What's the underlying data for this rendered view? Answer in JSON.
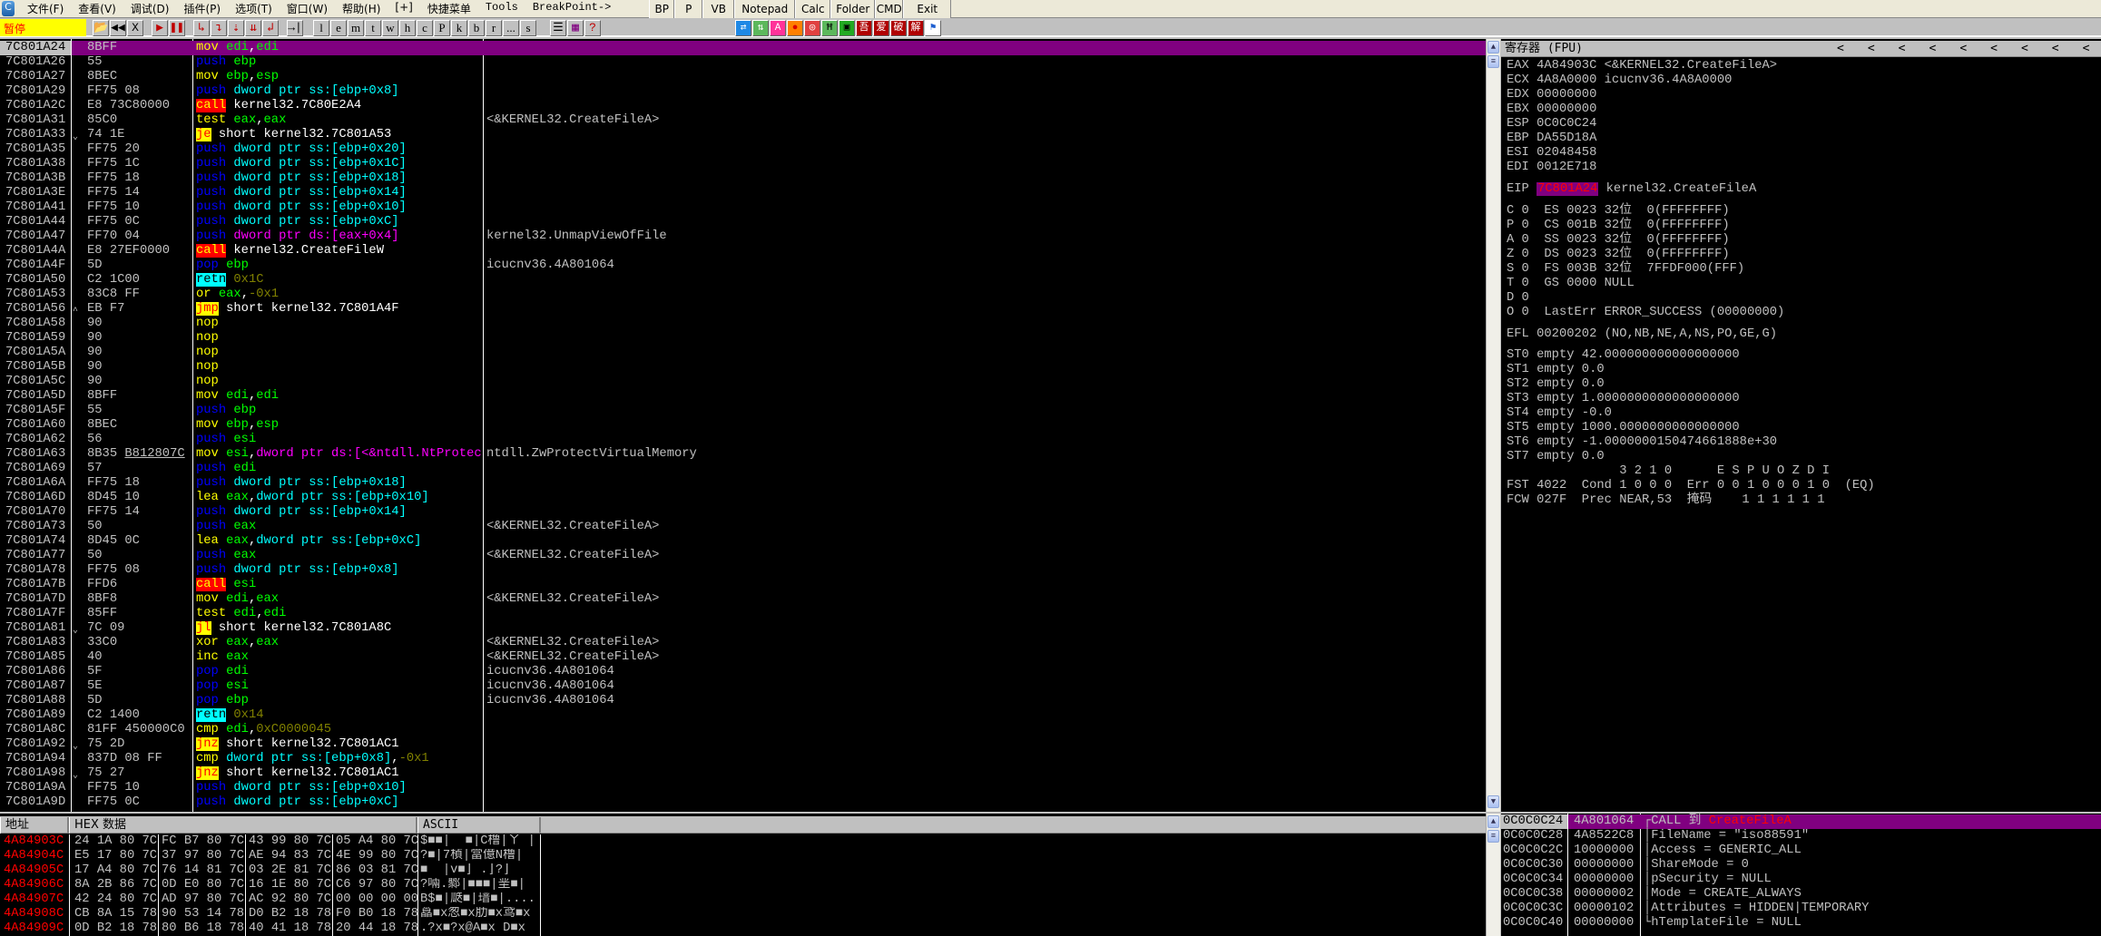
{
  "menubar": {
    "items": [
      "文件(F)",
      "查看(V)",
      "调试(D)",
      "插件(P)",
      "选项(T)",
      "窗口(W)",
      "帮助(H)",
      "[+]",
      "快捷菜单"
    ],
    "mono_items": [
      "Tools",
      "BreakPoint->"
    ],
    "quick_buttons": [
      "BP",
      "P",
      "VB",
      "Notepad",
      "Calc",
      "Folder",
      "CMD",
      "Exit"
    ]
  },
  "toolbar": {
    "status": "暂停",
    "controls": [
      {
        "g": "📂",
        "n": "open-icon",
        "c": "#b08000"
      },
      {
        "g": "◀◀",
        "n": "rewind-icon",
        "c": "#000"
      },
      {
        "g": "X",
        "n": "close-icon",
        "c": "#000"
      },
      {
        "g": "▶",
        "n": "run-icon",
        "c": "#c00000"
      },
      {
        "g": "❚❚",
        "n": "pause-icon",
        "c": "#c00000"
      },
      {
        "g": "↳",
        "n": "step-into-icon",
        "c": "#c00000"
      },
      {
        "g": "↴",
        "n": "step-over-icon",
        "c": "#c00000"
      },
      {
        "g": "⇣",
        "n": "trace-into-icon",
        "c": "#c00000"
      },
      {
        "g": "⇊",
        "n": "trace-over-icon",
        "c": "#c00000"
      },
      {
        "g": "↲",
        "n": "execute-till-return-icon",
        "c": "#c00000"
      },
      {
        "g": "→|",
        "n": "goto-icon",
        "c": "#000"
      }
    ],
    "letters": [
      "l",
      "e",
      "m",
      "t",
      "w",
      "h",
      "c",
      "P",
      "k",
      "b",
      "r",
      "...",
      "s"
    ],
    "extra": [
      {
        "g": "☰",
        "n": "list-icon",
        "c": "#000"
      },
      {
        "g": "▦",
        "n": "options-icon",
        "c": "#800080"
      },
      {
        "g": "?",
        "n": "help-icon",
        "c": "#c00000"
      }
    ],
    "plugins": [
      {
        "g": "⇄",
        "n": "swap-icon",
        "bg": "#1e88e5",
        "c": "#fff"
      },
      {
        "g": "⇅",
        "n": "updown-icon",
        "bg": "#5cb85c",
        "c": "#fff"
      },
      {
        "g": "A",
        "n": "ascii-icon",
        "bg": "#ff3399",
        "c": "#fff"
      },
      {
        "g": "●",
        "n": "record-icon",
        "bg": "#ff8000",
        "c": "#d00"
      },
      {
        "g": "◎",
        "n": "target-icon",
        "bg": "#e04040",
        "c": "#fff"
      },
      {
        "g": "Ħ",
        "n": "hex-icon",
        "bg": "#5cb85c",
        "c": "#000"
      },
      {
        "g": "▣",
        "n": "window-icon",
        "bg": "#22aa22",
        "c": "#000"
      },
      {
        "g": "吾",
        "n": "wu-icon",
        "bg": "#b00000",
        "c": "#fff"
      },
      {
        "g": "爱",
        "n": "ai-icon",
        "bg": "#b00000",
        "c": "#fff"
      },
      {
        "g": "破",
        "n": "po-icon",
        "bg": "#b00000",
        "c": "#fff"
      },
      {
        "g": "解",
        "n": "jie-icon",
        "bg": "#b00000",
        "c": "#fff"
      },
      {
        "g": "⚑",
        "n": "flag-icon",
        "bg": "#fff",
        "c": "#1e5fd0"
      }
    ]
  },
  "disasm": {
    "current": "7C801A24",
    "rows": [
      {
        "a": "7C801A24",
        "j": "",
        "h": "8BFF",
        "i": "mov edi,edi",
        "c": ""
      },
      {
        "a": "7C801A26",
        "j": "",
        "h": "55",
        "i": "push ebp",
        "c": ""
      },
      {
        "a": "7C801A27",
        "j": "",
        "h": "8BEC",
        "i": "mov ebp,esp",
        "c": ""
      },
      {
        "a": "7C801A29",
        "j": "",
        "h": "FF75 08",
        "i": "push dword ptr ss:[ebp+0x8]",
        "c": ""
      },
      {
        "a": "7C801A2C",
        "j": "",
        "h": "E8 73C80000",
        "i": "call kernel32.7C80E2A4",
        "c": ""
      },
      {
        "a": "7C801A31",
        "j": "",
        "h": "85C0",
        "i": "test eax,eax",
        "c": "<&KERNEL32.CreateFileA>"
      },
      {
        "a": "7C801A33",
        "j": "⌄",
        "h": "74 1E",
        "i": "je short kernel32.7C801A53",
        "c": ""
      },
      {
        "a": "7C801A35",
        "j": "",
        "h": "FF75 20",
        "i": "push dword ptr ss:[ebp+0x20]",
        "c": ""
      },
      {
        "a": "7C801A38",
        "j": "",
        "h": "FF75 1C",
        "i": "push dword ptr ss:[ebp+0x1C]",
        "c": ""
      },
      {
        "a": "7C801A3B",
        "j": "",
        "h": "FF75 18",
        "i": "push dword ptr ss:[ebp+0x18]",
        "c": ""
      },
      {
        "a": "7C801A3E",
        "j": "",
        "h": "FF75 14",
        "i": "push dword ptr ss:[ebp+0x14]",
        "c": ""
      },
      {
        "a": "7C801A41",
        "j": "",
        "h": "FF75 10",
        "i": "push dword ptr ss:[ebp+0x10]",
        "c": ""
      },
      {
        "a": "7C801A44",
        "j": "",
        "h": "FF75 0C",
        "i": "push dword ptr ss:[ebp+0xC]",
        "c": ""
      },
      {
        "a": "7C801A47",
        "j": "",
        "h": "FF70 04",
        "i": "push dword ptr ds:[eax+0x4]",
        "c": "kernel32.UnmapViewOfFile"
      },
      {
        "a": "7C801A4A",
        "j": "",
        "h": "E8 27EF0000",
        "i": "call kernel32.CreateFileW",
        "c": ""
      },
      {
        "a": "7C801A4F",
        "j": "",
        "h": "5D",
        "i": "pop ebp",
        "c": "icucnv36.4A801064"
      },
      {
        "a": "7C801A50",
        "j": "",
        "h": "C2 1C00",
        "i": "retn 0x1C",
        "c": ""
      },
      {
        "a": "7C801A53",
        "j": "",
        "h": "83C8 FF",
        "i": "or eax,-0x1",
        "c": ""
      },
      {
        "a": "7C801A56",
        "j": "^",
        "h": "EB F7",
        "i": "jmp short kernel32.7C801A4F",
        "c": ""
      },
      {
        "a": "7C801A58",
        "j": "",
        "h": "90",
        "i": "nop",
        "c": ""
      },
      {
        "a": "7C801A59",
        "j": "",
        "h": "90",
        "i": "nop",
        "c": ""
      },
      {
        "a": "7C801A5A",
        "j": "",
        "h": "90",
        "i": "nop",
        "c": ""
      },
      {
        "a": "7C801A5B",
        "j": "",
        "h": "90",
        "i": "nop",
        "c": ""
      },
      {
        "a": "7C801A5C",
        "j": "",
        "h": "90",
        "i": "nop",
        "c": ""
      },
      {
        "a": "7C801A5D",
        "j": "",
        "h": "8BFF",
        "i": "mov edi,edi",
        "c": ""
      },
      {
        "a": "7C801A5F",
        "j": "",
        "h": "55",
        "i": "push ebp",
        "c": ""
      },
      {
        "a": "7C801A60",
        "j": "",
        "h": "8BEC",
        "i": "mov ebp,esp",
        "c": ""
      },
      {
        "a": "7C801A62",
        "j": "",
        "h": "56",
        "i": "push esi",
        "c": ""
      },
      {
        "a": "7C801A63",
        "j": "",
        "h": "8B35",
        "hu": "B812807C",
        "i": "mov esi,dword ptr ds:[<&ntdll.NtProtect",
        "c": "ntdll.ZwProtectVirtualMemory"
      },
      {
        "a": "7C801A69",
        "j": "",
        "h": "57",
        "i": "push edi",
        "c": ""
      },
      {
        "a": "7C801A6A",
        "j": "",
        "h": "FF75 18",
        "i": "push dword ptr ss:[ebp+0x18]",
        "c": ""
      },
      {
        "a": "7C801A6D",
        "j": "",
        "h": "8D45 10",
        "i": "lea eax,dword ptr ss:[ebp+0x10]",
        "c": ""
      },
      {
        "a": "7C801A70",
        "j": "",
        "h": "FF75 14",
        "i": "push dword ptr ss:[ebp+0x14]",
        "c": ""
      },
      {
        "a": "7C801A73",
        "j": "",
        "h": "50",
        "i": "push eax",
        "c": "<&KERNEL32.CreateFileA>"
      },
      {
        "a": "7C801A74",
        "j": "",
        "h": "8D45 0C",
        "i": "lea eax,dword ptr ss:[ebp+0xC]",
        "c": ""
      },
      {
        "a": "7C801A77",
        "j": "",
        "h": "50",
        "i": "push eax",
        "c": "<&KERNEL32.CreateFileA>"
      },
      {
        "a": "7C801A78",
        "j": "",
        "h": "FF75 08",
        "i": "push dword ptr ss:[ebp+0x8]",
        "c": ""
      },
      {
        "a": "7C801A7B",
        "j": "",
        "h": "FFD6",
        "i": "call esi",
        "c": ""
      },
      {
        "a": "7C801A7D",
        "j": "",
        "h": "8BF8",
        "i": "mov edi,eax",
        "c": "<&KERNEL32.CreateFileA>"
      },
      {
        "a": "7C801A7F",
        "j": "",
        "h": "85FF",
        "i": "test edi,edi",
        "c": ""
      },
      {
        "a": "7C801A81",
        "j": "⌄",
        "h": "7C 09",
        "i": "jl short kernel32.7C801A8C",
        "c": ""
      },
      {
        "a": "7C801A83",
        "j": "",
        "h": "33C0",
        "i": "xor eax,eax",
        "c": "<&KERNEL32.CreateFileA>"
      },
      {
        "a": "7C801A85",
        "j": "",
        "h": "40",
        "i": "inc eax",
        "c": "<&KERNEL32.CreateFileA>"
      },
      {
        "a": "7C801A86",
        "j": "",
        "h": "5F",
        "i": "pop edi",
        "c": "icucnv36.4A801064"
      },
      {
        "a": "7C801A87",
        "j": "",
        "h": "5E",
        "i": "pop esi",
        "c": "icucnv36.4A801064"
      },
      {
        "a": "7C801A88",
        "j": "",
        "h": "5D",
        "i": "pop ebp",
        "c": "icucnv36.4A801064"
      },
      {
        "a": "7C801A89",
        "j": "",
        "h": "C2 1400",
        "i": "retn 0x14",
        "c": ""
      },
      {
        "a": "7C801A8C",
        "j": "",
        "h": "81FF 450000C0",
        "i": "cmp edi,0xC0000045",
        "c": ""
      },
      {
        "a": "7C801A92",
        "j": "⌄",
        "h": "75 2D",
        "i": "jnz short kernel32.7C801AC1",
        "c": ""
      },
      {
        "a": "7C801A94",
        "j": "",
        "h": "837D 08 FF",
        "i": "cmp dword ptr ss:[ebp+0x8],-0x1",
        "c": ""
      },
      {
        "a": "7C801A98",
        "j": "⌄",
        "h": "75 27",
        "i": "jnz short kernel32.7C801AC1",
        "c": ""
      },
      {
        "a": "7C801A9A",
        "j": "",
        "h": "FF75 10",
        "i": "push dword ptr ss:[ebp+0x10]",
        "c": ""
      },
      {
        "a": "7C801A9D",
        "j": "",
        "h": "FF75 0C",
        "i": "push dword ptr ss:[ebp+0xC]",
        "c": ""
      }
    ]
  },
  "registers": {
    "title": "寄存器 (FPU)",
    "arrows": [
      "<",
      "<",
      "<",
      "<",
      "<",
      "<",
      "<",
      "<",
      "<"
    ],
    "gp": [
      {
        "n": "EAX",
        "v": "4A84903C",
        "c": "<&KERNEL32.CreateFileA>"
      },
      {
        "n": "ECX",
        "v": "4A8A0000",
        "c": "icucnv36.4A8A0000"
      },
      {
        "n": "EDX",
        "v": "00000000",
        "c": ""
      },
      {
        "n": "EBX",
        "v": "00000000",
        "c": ""
      },
      {
        "n": "ESP",
        "v": "0C0C0C24",
        "c": ""
      },
      {
        "n": "EBP",
        "v": "DA55D18A",
        "c": ""
      },
      {
        "n": "ESI",
        "v": "02048458",
        "c": ""
      },
      {
        "n": "EDI",
        "v": "0012E718",
        "c": ""
      }
    ],
    "eip": {
      "n": "EIP",
      "v": "7C801A24",
      "c": "kernel32.CreateFileA"
    },
    "flags": [
      "C 0  ES 0023 32位  0(FFFFFFFF)",
      "P 0  CS 001B 32位  0(FFFFFFFF)",
      "A 0  SS 0023 32位  0(FFFFFFFF)",
      "Z 0  DS 0023 32位  0(FFFFFFFF)",
      "S 0  FS 003B 32位  7FFDF000(FFF)",
      "T 0  GS 0000 NULL",
      "D 0",
      "O 0  LastErr ERROR_SUCCESS (00000000)"
    ],
    "efl": "EFL 00200202 (NO,NB,NE,A,NS,PO,GE,G)",
    "fpu": [
      "ST0 empty 42.000000000000000000",
      "ST1 empty 0.0",
      "ST2 empty 0.0",
      "ST3 empty 1.0000000000000000000",
      "ST4 empty -0.0",
      "ST5 empty 1000.0000000000000000",
      "ST6 empty -1.0000000150474661888e+30",
      "ST7 empty 0.0",
      "               3 2 1 0      E S P U O Z D I",
      "FST 4022  Cond 1 0 0 0  Err 0 0 1 0 0 0 1 0  (EQ)",
      "FCW 027F  Prec NEAR,53  掩码    1 1 1 1 1 1"
    ]
  },
  "dump": {
    "headers": {
      "addr": "地址",
      "hex": "HEX 数据",
      "ascii": "ASCII"
    },
    "rows": [
      {
        "a": "4A84903C",
        "h": [
          "24 1A 80 7C",
          "FC B7 80 7C",
          "43 99 80 7C",
          "05 A4 80 7C"
        ],
        "s": "$■■|  ■|C橹|ㄚ |"
      },
      {
        "a": "4A84904C",
        "h": [
          "E5 17 80 7C",
          "37 97 80 7C",
          "AE 94 83 7C",
          "4E 99 80 7C"
        ],
        "s": "?■|7楨|當億N橹|"
      },
      {
        "a": "4A84905C",
        "h": [
          "17 A4 80 7C",
          "76 14 81 7C",
          "03 2E 81 7C",
          "86 03 81 7C"
        ],
        "s": "■  |v■⌋ .⌋?⌋"
      },
      {
        "a": "4A84906C",
        "h": [
          "8A 2B 86 7C",
          "0D E0 80 7C",
          "16 1E 80 7C",
          "C6 97 80 7C"
        ],
        "s": "?啢.鄹|■■■|垩■|"
      },
      {
        "a": "4A84907C",
        "h": [
          "42 24 80 7C",
          "AD 97 80 7C",
          "AC 92 80 7C",
          "00 00 00 00"
        ],
        "s": "B$■|瓞■|瑨■|...."
      },
      {
        "a": "4A84908C",
        "h": [
          "CB 8A 15 78",
          "90 53 14 78",
          "D0 B2 18 78",
          "F0 B0 18 78"
        ],
        "s": "藠■x怱■x肋■x鸢■x"
      },
      {
        "a": "4A84909C",
        "h": [
          "0D B2 18 78",
          "80 B6 18 78",
          "40 41 18 78",
          "20 44 18 78"
        ],
        "s": ".?x■?x@A■x D■x"
      }
    ]
  },
  "stack": {
    "rows": [
      {
        "a": "0C0C0C24",
        "v": "4A801064",
        "c": "┌CALL 到 ",
        "f": "CreateFileA"
      },
      {
        "a": "0C0C0C28",
        "v": "4A8522C8",
        "c": "│FileName = \"iso88591\""
      },
      {
        "a": "0C0C0C2C",
        "v": "10000000",
        "c": "│Access = GENERIC_ALL"
      },
      {
        "a": "0C0C0C30",
        "v": "00000000",
        "c": "│ShareMode = 0"
      },
      {
        "a": "0C0C0C34",
        "v": "00000000",
        "c": "│pSecurity = NULL"
      },
      {
        "a": "0C0C0C38",
        "v": "00000002",
        "c": "│Mode = CREATE_ALWAYS"
      },
      {
        "a": "0C0C0C3C",
        "v": "00000102",
        "c": "│Attributes = HIDDEN|TEMPORARY"
      },
      {
        "a": "0C0C0C40",
        "v": "00000000",
        "c": "└hTemplateFile = NULL"
      }
    ]
  },
  "colors": {
    "highlight": "#800080",
    "eip_text": "#ff0000",
    "dump_addr": "#ff0000"
  }
}
